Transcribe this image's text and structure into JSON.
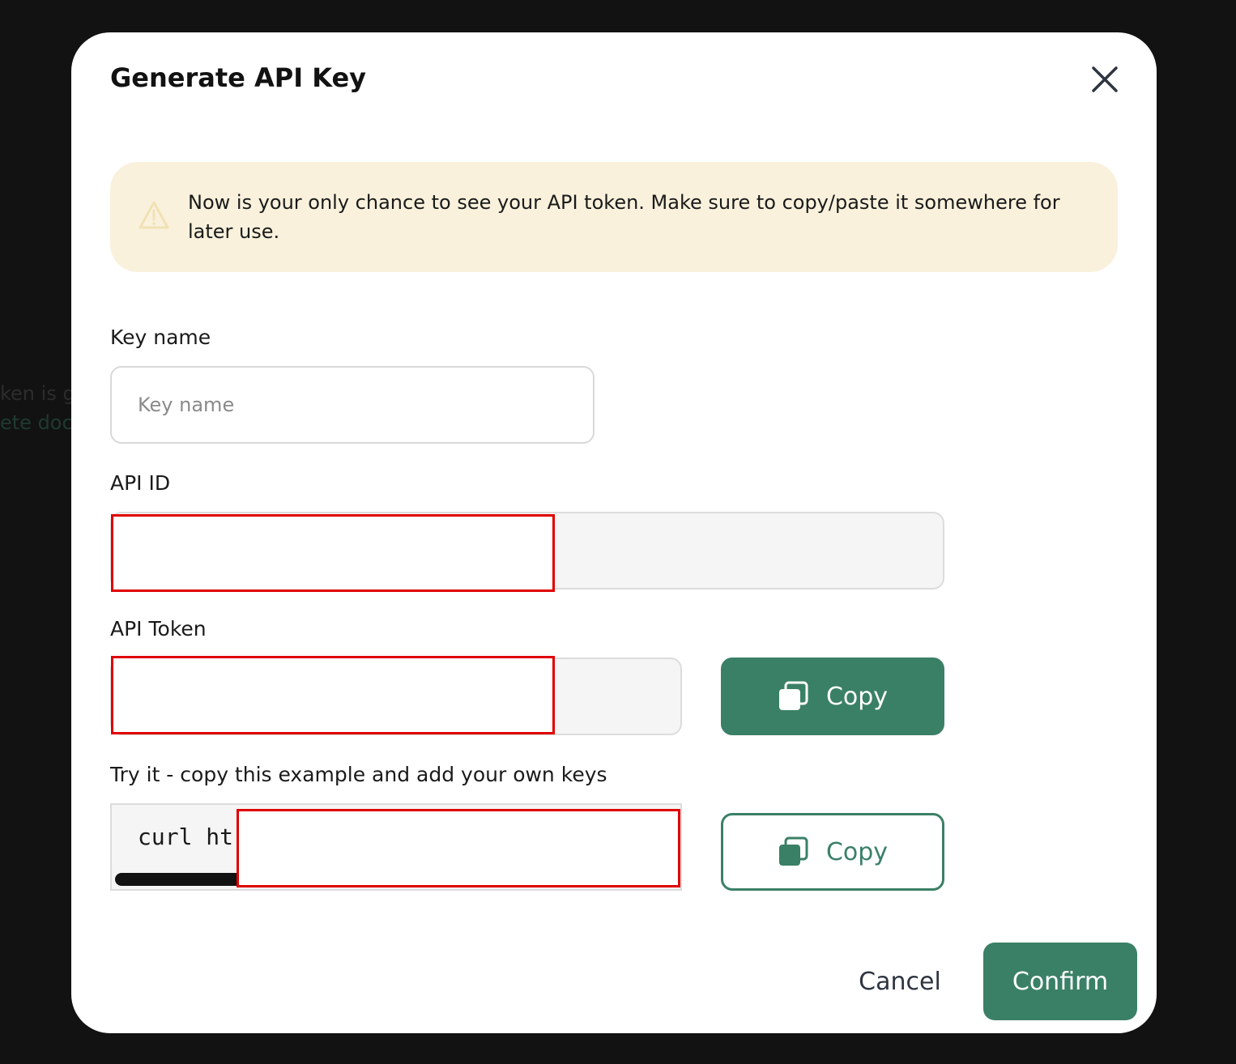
{
  "backdrop": {
    "line1": "ken is g",
    "line2": "ete doc"
  },
  "modal": {
    "title": "Generate API Key",
    "close_icon": "close-icon",
    "alert": {
      "icon": "warning-icon",
      "text": "Now is your only chance to see your API token. Make sure to copy/paste it somewhere for later use."
    },
    "key_name": {
      "label": "Key name",
      "placeholder": "Key name",
      "value": ""
    },
    "api_id": {
      "label": "API ID"
    },
    "api_token": {
      "label": "API Token",
      "copy_label": "Copy",
      "copy_icon": "copy-icon"
    },
    "example": {
      "label": "Try it - copy this example and add your own keys",
      "code": "curl ht",
      "copy_label": "Copy",
      "copy_icon": "copy-icon"
    },
    "cancel_label": "Cancel",
    "confirm_label": "Confirm"
  },
  "colors": {
    "accent": "#3a8066",
    "alert_bg": "#f9f1dc",
    "redaction": "#e00000",
    "backdrop": "#121212"
  }
}
